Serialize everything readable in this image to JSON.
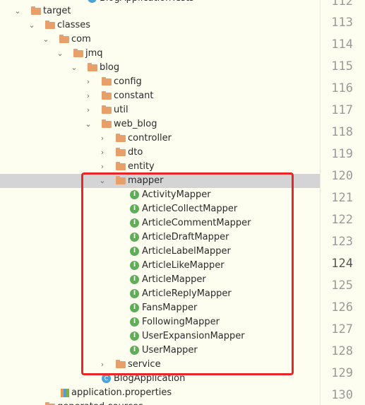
{
  "tree": {
    "top_partial_label": "BlogApplicationTests",
    "target": "target",
    "classes": "classes",
    "com": "com",
    "jmq": "jmq",
    "blog": "blog",
    "config": "config",
    "constant": "constant",
    "util": "util",
    "web_blog": "web_blog",
    "controller": "controller",
    "dto": "dto",
    "entity": "entity",
    "mapper": "mapper",
    "mappers": [
      "ActivityMapper",
      "ArticleCollectMapper",
      "ArticleCommentMapper",
      "ArticleDraftMapper",
      "ArticleLabelMapper",
      "ArticleLikeMapper",
      "ArticleMapper",
      "ArticleReplyMapper",
      "FansMapper",
      "FollowingMapper",
      "UserExpansionMapper",
      "UserMapper"
    ],
    "service": "service",
    "blog_application": "BlogApplication",
    "application_properties": "application.properties",
    "bottom_partial_label": "generated-sources"
  },
  "gutter": {
    "line_numbers": [
      "112",
      "113",
      "114",
      "115",
      "116",
      "117",
      "118",
      "119",
      "120",
      "121",
      "122",
      "123",
      "124",
      "125",
      "126",
      "127",
      "128",
      "129",
      "130"
    ],
    "current_line": "124"
  },
  "icons": {
    "interface_badge": "I",
    "class_badge": "C"
  },
  "colors": {
    "highlight_border": "#e8262a",
    "folder": "#e8a06a",
    "interface_icon": "#5fad56",
    "selection": "#d4d4d4"
  }
}
